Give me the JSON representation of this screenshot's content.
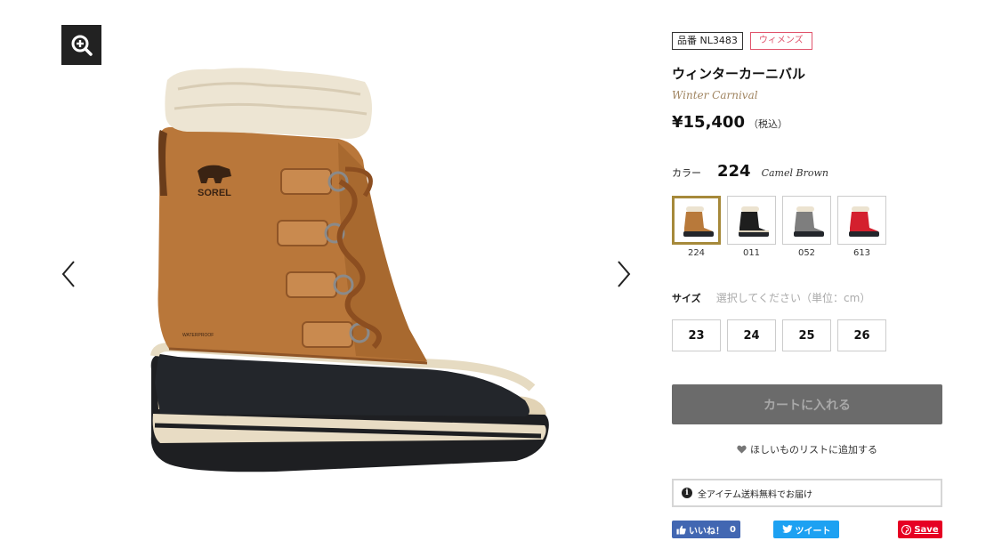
{
  "gallery": {
    "zoom_icon": "zoom-in-icon",
    "prev_icon": "chevron-left-icon",
    "next_icon": "chevron-right-icon",
    "brand_on_product": "SOREL",
    "product_print": "WATERPROOF"
  },
  "product": {
    "code_label": "品番 NL3483",
    "category_badge": "ウィメンズ",
    "name_ja": "ウィンターカーニバル",
    "name_en": "Winter Carnival",
    "price": "¥15,400",
    "tax_note": "（税込）"
  },
  "color": {
    "label": "カラー",
    "selected_code": "224",
    "selected_name": "Camel Brown",
    "options": [
      {
        "code": "224",
        "hex": "#b8793a"
      },
      {
        "code": "011",
        "hex": "#1e1e1e"
      },
      {
        "code": "052",
        "hex": "#7e7e7e"
      },
      {
        "code": "613",
        "hex": "#d4202e"
      }
    ]
  },
  "size": {
    "label": "サイズ",
    "hint": "選択してください（単位：cm）",
    "options": [
      "23",
      "24",
      "25",
      "26"
    ]
  },
  "actions": {
    "cart_label": "カートに入れる",
    "wishlist_label": "ほしいものリストに追加する",
    "wishlist_icon": "heart-icon"
  },
  "shipping_notice": "全アイテム送料無料でお届け",
  "social": {
    "facebook_label": "いいね！",
    "facebook_count": "0",
    "twitter_label": "ツイート",
    "pinterest_label": "Save"
  },
  "colors": {
    "cart_bg": "#6b6b6b",
    "selected_border": "#a6893a",
    "women_badge": "#e0546c",
    "facebook": "#4267b2",
    "twitter": "#1da1f2",
    "pinterest": "#e60023"
  }
}
